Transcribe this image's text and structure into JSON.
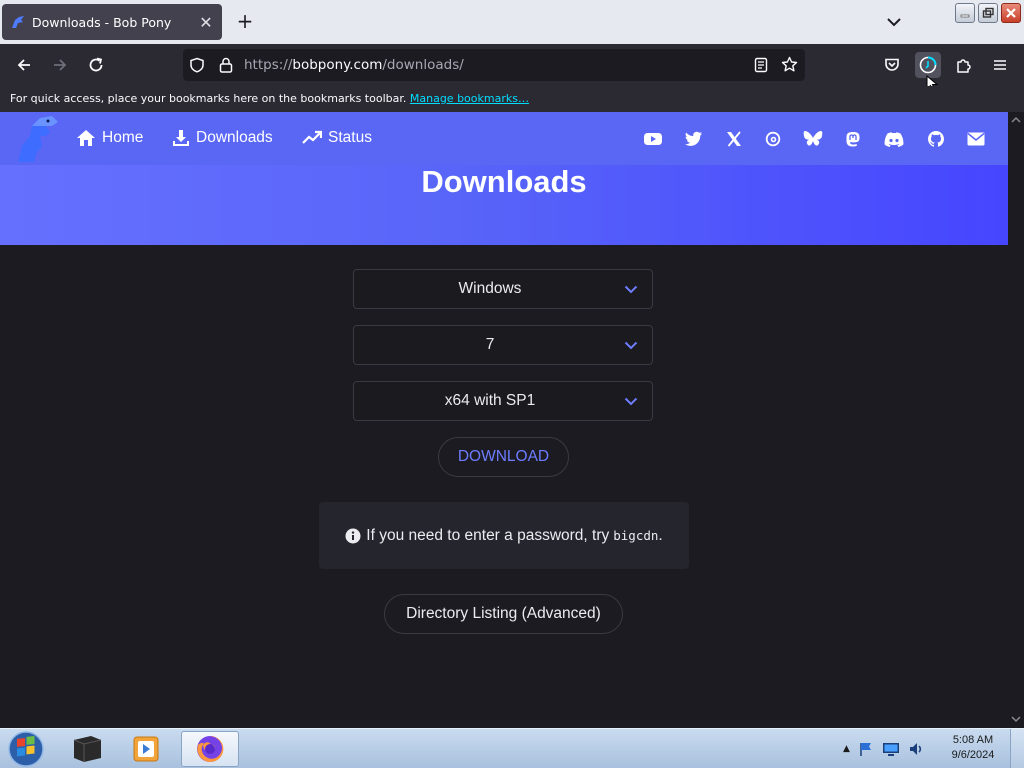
{
  "browser": {
    "tab": {
      "title": "Downloads - Bob Pony",
      "close_glyph": "✕"
    },
    "newtab_glyph": "+",
    "url": {
      "scheme": "https://",
      "host": "bobpony.com",
      "path": "/downloads/"
    },
    "bookmarks_bar": {
      "text": "For quick access, place your bookmarks here on the bookmarks toolbar.",
      "link": "Manage bookmarks…"
    }
  },
  "site": {
    "nav": [
      {
        "label": "Home",
        "icon": "home-icon"
      },
      {
        "label": "Downloads",
        "icon": "download-icon"
      },
      {
        "label": "Status",
        "icon": "trend-icon"
      }
    ],
    "social_icons": [
      "youtube-icon",
      "twitter-icon",
      "x-icon",
      "threads-icon",
      "bluesky-icon",
      "mastodon-icon",
      "discord-icon",
      "github-icon",
      "mail-icon"
    ],
    "title": "Downloads"
  },
  "form": {
    "os": "Windows",
    "version": "7",
    "edition": "x64 with SP1",
    "download_label": "DOWNLOAD"
  },
  "notice": {
    "text": "If you need to enter a password, try",
    "code": "bigcdn",
    "suffix": "."
  },
  "directory_label": "Directory Listing (Advanced)",
  "taskbar": {
    "time": "5:08 AM",
    "date": "9/6/2024",
    "tray_arrow": "▲"
  },
  "colors": {
    "accent": "#5a67f5",
    "link": "#6d7cff",
    "page_bg": "#1c1b22"
  }
}
